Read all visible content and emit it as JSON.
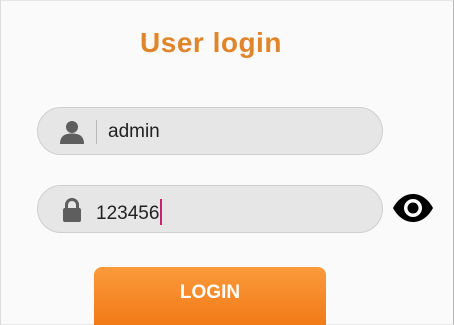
{
  "login": {
    "title": "User login",
    "username": {
      "icon": "user-icon",
      "value": "admin"
    },
    "password": {
      "icon": "lock-icon",
      "value": "123456",
      "toggle_icon": "eye-icon"
    },
    "button_label": "LOGIN"
  },
  "colors": {
    "accent": "#e0852a",
    "button": "#f7891f",
    "caret": "#d0206a",
    "field_bg": "#e6e6e6"
  }
}
